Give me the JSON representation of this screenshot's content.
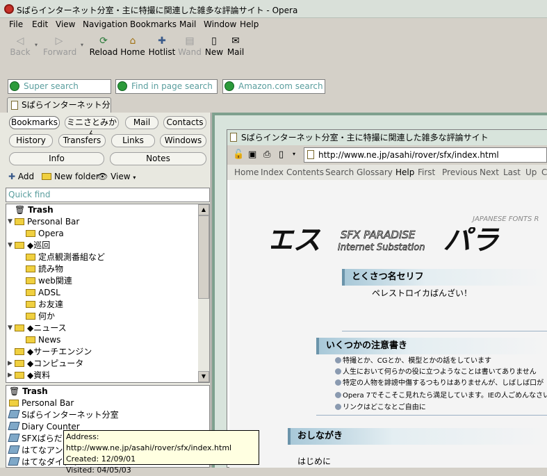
{
  "window": {
    "title": "Sぱらインターネット分室・主に特撮に関連した雑多な評論サイト - Opera"
  },
  "menu": [
    "File",
    "Edit",
    "View",
    "Navigation",
    "Bookmarks",
    "Mail",
    "Window",
    "Help"
  ],
  "toolbar": {
    "back": "Back",
    "forward": "Forward",
    "reload": "Reload",
    "home": "Home",
    "hotlist": "Hotlist",
    "wand": "Wand",
    "new": "New",
    "mail": "Mail"
  },
  "search": {
    "super": "Super search",
    "find": "Find in page search",
    "amazon": "Amazon.com search"
  },
  "tab": {
    "label": "Sぱらインターネット分室..."
  },
  "panel": {
    "buttons": [
      "Bookmarks",
      "ミニさとみかん",
      "Mail",
      "Contacts",
      "History",
      "Transfers",
      "Links",
      "Windows",
      "Info",
      "Notes"
    ],
    "actions": {
      "add": "Add",
      "new_folder": "New folder",
      "view": "View"
    },
    "quick_find": "Quick find",
    "tree": [
      {
        "label": "Trash"
      },
      {
        "label": "Personal Bar"
      },
      {
        "label": "Opera"
      },
      {
        "label": "◆巡回"
      },
      {
        "label": "定点観測番組など"
      },
      {
        "label": "読み物"
      },
      {
        "label": "web関連"
      },
      {
        "label": "ADSL"
      },
      {
        "label": "お友達"
      },
      {
        "label": "何か"
      },
      {
        "label": "◆ニュース"
      },
      {
        "label": "News"
      },
      {
        "label": "◆サーチエンジン"
      },
      {
        "label": "◆コンピュータ"
      },
      {
        "label": "◆資料"
      }
    ],
    "list": [
      {
        "label": "Trash"
      },
      {
        "label": "Personal Bar"
      },
      {
        "label": "Sぱらインターネット分室"
      },
      {
        "label": "Diary Counter"
      },
      {
        "label": "SFXぱらだい"
      },
      {
        "label": "はてなアンテナ"
      },
      {
        "label": "はてなダイアリ"
      }
    ]
  },
  "tooltip": {
    "address": "Address: http://www.ne.jp/asahi/rover/sfx/index.html",
    "created": "Created: 12/09/01",
    "visited": "Visited: 04/05/03"
  },
  "document": {
    "title": "Sぱらインターネット分室・主に特撮に関連した雑多な評論サイト",
    "url": "http://www.ne.jp/asahi/rover/sfx/index.html",
    "nav": [
      "Home",
      "Index",
      "Contents",
      "Search",
      "Glossary",
      "Help",
      "First",
      "Previous",
      "Next",
      "Last",
      "Up",
      "C"
    ],
    "page": {
      "japanese_fonts": "JAPANESE FONTS R",
      "logo_text": "SFX PARADISE Internet Substation",
      "h1": "とくさつ名セリフ",
      "quote": "ペレストロイカばんざい！",
      "h2": "いくつかの注意書き",
      "notes": [
        "特撮とか、CGとか、模型とかの話をしています",
        "人生において何らかの役に立つようなことは書いてありません",
        "特定の人物を誹謗中傷するつもりはありませんが、しばしば口が",
        "Opera 7でそこそこ見れたら満足しています。IEの人ごめんなさい",
        "リンクはどこなとご自由に"
      ],
      "h3": "おしながき",
      "first_item": "はじめに"
    }
  }
}
